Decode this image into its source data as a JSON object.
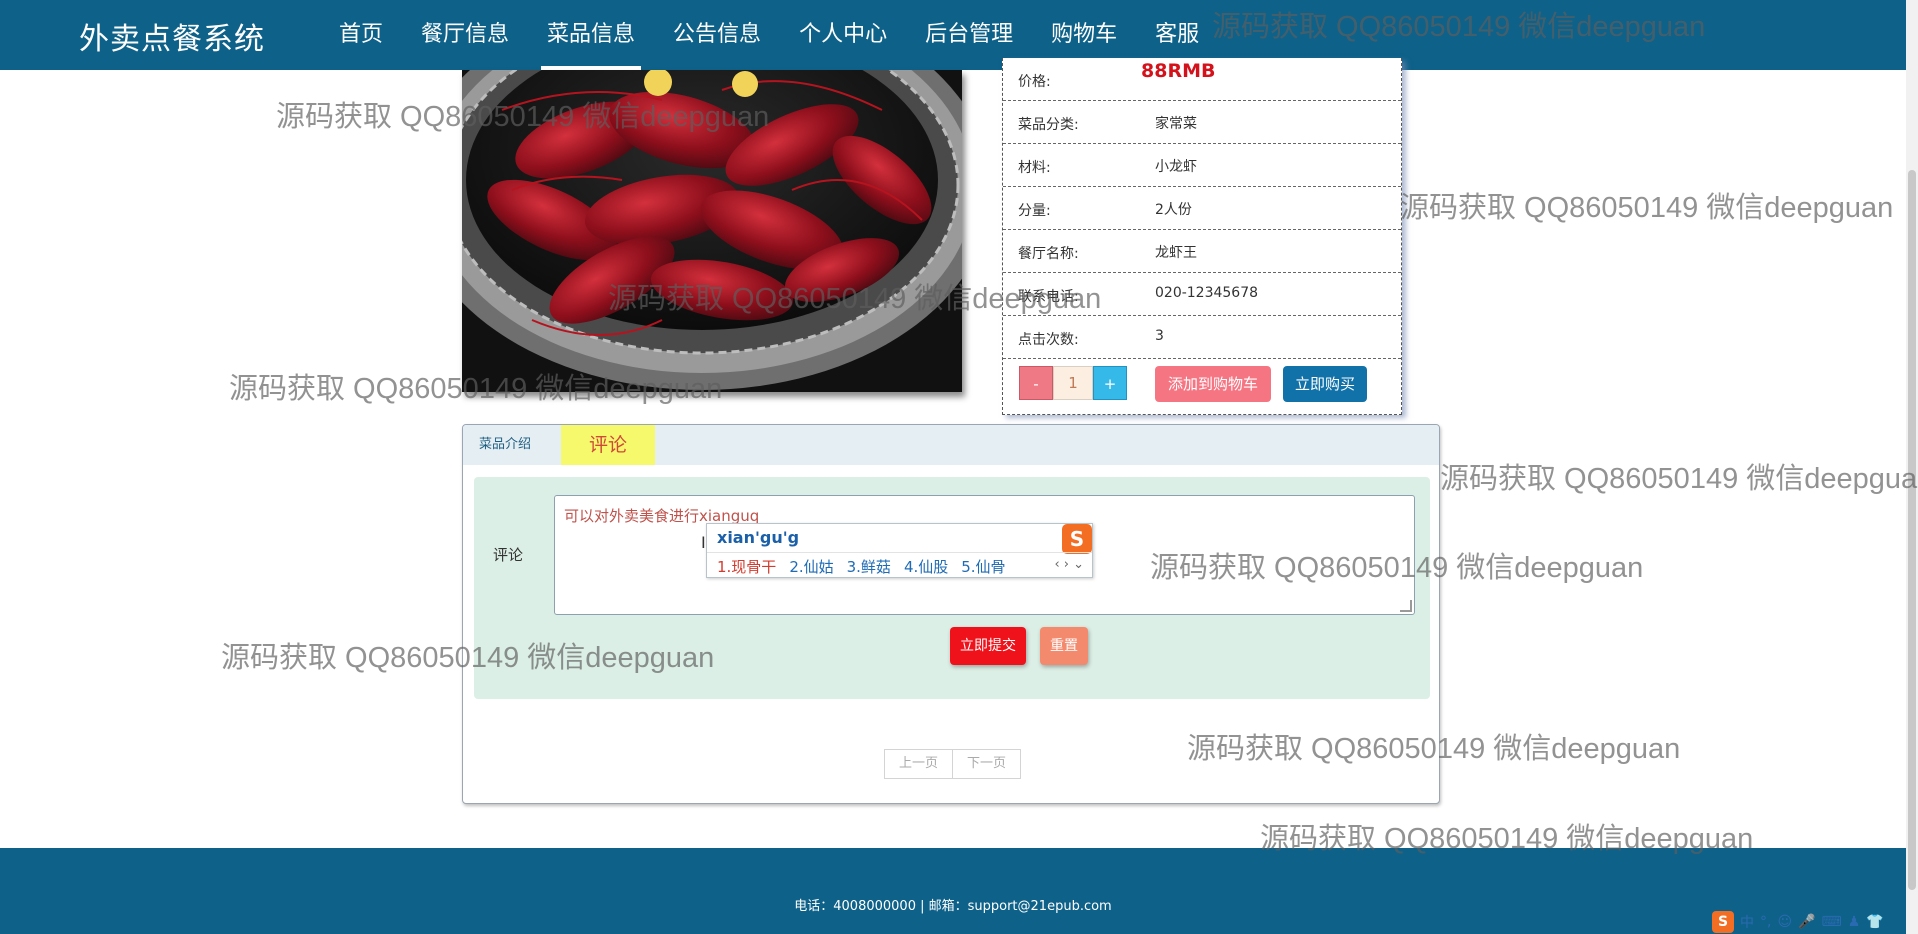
{
  "nav": {
    "brand": "外卖点餐系统",
    "items": [
      {
        "label": "首页"
      },
      {
        "label": "餐厅信息"
      },
      {
        "label": "菜品信息",
        "active": true
      },
      {
        "label": "公告信息"
      },
      {
        "label": "个人中心"
      },
      {
        "label": "后台管理"
      },
      {
        "label": "购物车"
      },
      {
        "label": "客服"
      }
    ]
  },
  "product": {
    "image_icon": "crayfish-dish-photo",
    "rows": [
      {
        "label": "价格:",
        "value": "88RMB"
      },
      {
        "label": "菜品分类:",
        "value": "家常菜"
      },
      {
        "label": "材料:",
        "value": "小龙虾"
      },
      {
        "label": "分量:",
        "value": "2人份"
      },
      {
        "label": "餐厅名称:",
        "value": "龙虾王"
      },
      {
        "label": "联系电话:",
        "value": "020-12345678"
      },
      {
        "label": "点击次数:",
        "value": "3"
      }
    ],
    "quantity": {
      "minus": "-",
      "value": "1",
      "plus": "+"
    },
    "add_to_cart": "添加到购物车",
    "buy_now": "立即购买"
  },
  "comments": {
    "tabs": {
      "intro": "菜品介绍",
      "comment": "评论"
    },
    "label": "评论",
    "textarea_value": "可以对外卖美食进行xianguq",
    "submit": "立即提交",
    "reset": "重置",
    "pager": {
      "prev": "上一页",
      "next": "下一页"
    }
  },
  "ime": {
    "input": "xian'gu'g",
    "candidates": [
      "1.现骨干",
      "2.仙姑",
      "3.鲜菇",
      "4.仙股",
      "5.仙骨"
    ],
    "logo": "S",
    "arrows": "‹ › ⌄"
  },
  "footer": {
    "text": "电话：4008000000 | 邮箱：support@21epub.com"
  },
  "tray": {
    "logo": "S",
    "items": [
      "中",
      "°,",
      "☺",
      "🎤",
      "⌨",
      "♟",
      "👕"
    ]
  },
  "watermark": "源码获取 QQ86050149 微信deepguan",
  "colors": {
    "header_bg": "#0e6189",
    "price": "#d3121b",
    "submit": "#f0121b",
    "reset": "#f38a6d",
    "add_to_cart": "#f57583",
    "buy_now": "#1171a9",
    "comment_tab": "#f6f96c",
    "form_bg": "#dcefe6"
  }
}
